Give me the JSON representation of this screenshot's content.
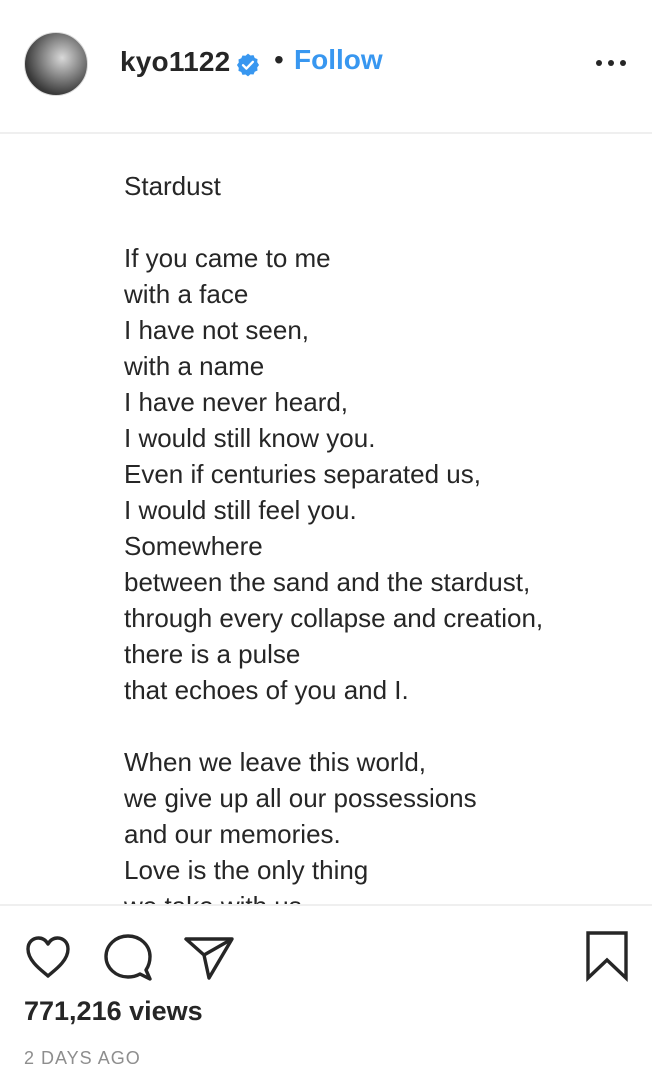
{
  "header": {
    "username": "kyo1122",
    "verified": true,
    "separator": "•",
    "follow_label": "Follow"
  },
  "caption": {
    "lines": [
      "Stardust",
      "",
      "If you came to me",
      "with a face",
      "I have not seen,",
      "with a name",
      "I have never heard,",
      "I would still know you.",
      "Even if centuries separated us,",
      "I would still feel you.",
      "Somewhere",
      "between the sand and the stardust,",
      "through every collapse and creation,",
      "there is a pulse",
      "that echoes of you and I.",
      "",
      "When we leave this world,",
      "we give up all our possessions",
      "and our memories.",
      "Love is the only thing",
      "we take with us."
    ]
  },
  "stats": {
    "views": "771,216 views",
    "posted": "2 DAYS AGO"
  },
  "icons": {
    "like": "heart-icon",
    "comment": "comment-icon",
    "share": "share-icon",
    "save": "bookmark-icon",
    "more": "more-options-icon",
    "verified": "verified-badge-icon"
  },
  "colors": {
    "follow": "#3897f0",
    "verified": "#3897f0",
    "text": "#262626",
    "muted": "#8e8e8e"
  }
}
